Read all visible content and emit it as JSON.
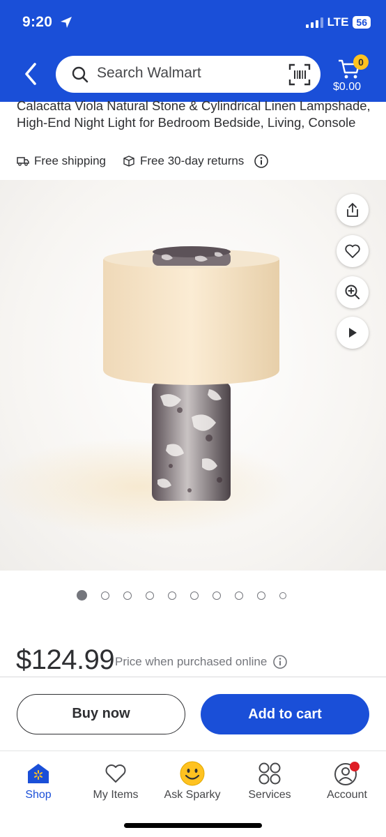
{
  "status_bar": {
    "time": "9:20",
    "network": "LTE",
    "battery": "56"
  },
  "search": {
    "placeholder": "Search Walmart"
  },
  "cart": {
    "count": "0",
    "total": "$0.00"
  },
  "product": {
    "title": "Calacatta Viola Natural  Stone & Cylindrical Linen Lampshade, High-End Night Light for Bedroom Bedside, Living, Console",
    "perks": [
      "Free shipping",
      "Free 30-day returns"
    ],
    "price": "$124.99",
    "price_note": "Price when purchased online"
  },
  "carousel": {
    "total_images": 10,
    "active_index": 0
  },
  "actions": {
    "buy_now": "Buy now",
    "add_to_cart": "Add to cart"
  },
  "bottom_nav": {
    "items": [
      {
        "label": "Shop",
        "icon": "shop-icon"
      },
      {
        "label": "My Items",
        "icon": "heart-icon"
      },
      {
        "label": "Ask Sparky",
        "icon": "sparky-icon"
      },
      {
        "label": "Services",
        "icon": "services-icon"
      },
      {
        "label": "Account",
        "icon": "account-icon"
      }
    ],
    "active": "Shop"
  },
  "colors": {
    "brand_blue": "#1a4fd8",
    "spark_yellow": "#ffc220",
    "text": "#2e2f32",
    "muted": "#74767c",
    "alert_red": "#de1c24"
  }
}
